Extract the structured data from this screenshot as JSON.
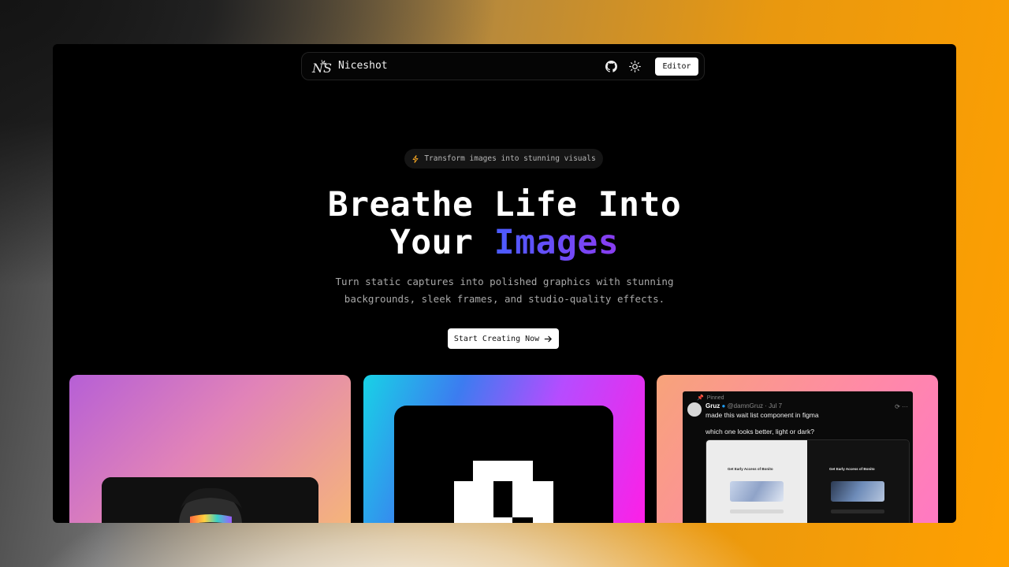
{
  "brand": {
    "name": "Niceshot",
    "logo_text": "NS"
  },
  "nav": {
    "github_icon": "github-icon",
    "theme_icon": "sun-icon",
    "editor_label": "Editor"
  },
  "hero": {
    "badge_icon": "lightning-icon",
    "badge_text": "Transform images into stunning visuals",
    "title_line1": "Breathe Life Into",
    "title_line2_plain": "Your",
    "title_line2_accent": "Images",
    "subtitle_line1": "Turn static captures into polished graphics with stunning",
    "subtitle_line2": "backgrounds, sleek frames, and studio-quality effects.",
    "cta_label": "Start Creating Now",
    "cta_icon": "arrow-right-icon"
  },
  "colors": {
    "accent_start": "#4a5cff",
    "accent_end": "#8a3cf0",
    "page_bg": "#000000"
  },
  "showcase": {
    "tweet": {
      "pinned_label": "Pinned",
      "name": "Gruz",
      "handle": "@damnGruz · Jul 7",
      "text_line1": "made this wait list component in figma",
      "text_line2": "which one looks better, light or dark?",
      "mini_title_light": "Get Early Access of Bonito",
      "mini_title_dark": "Get Early Access of Bonito"
    }
  }
}
